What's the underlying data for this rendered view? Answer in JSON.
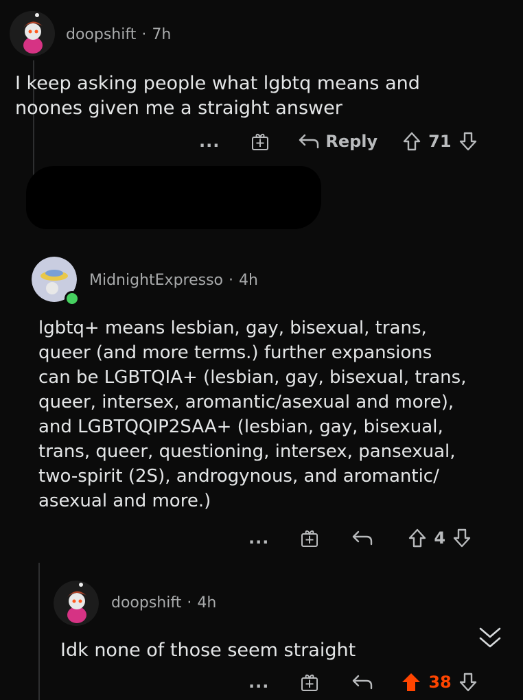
{
  "comments": [
    {
      "username": "doopshift",
      "age": "7h",
      "text_lines": [
        "I keep asking people what lgbtq means and",
        "noones given me a straight answer"
      ],
      "actions": {
        "more": "...",
        "reply_label": "Reply",
        "score": "71"
      }
    },
    {
      "username": "MidnightExpresso",
      "age": "4h",
      "text_lines": [
        "lgbtq+ means lesbian, gay, bisexual, trans,",
        "queer (and more terms.) further expansions",
        "can be LGBTQIA+ (lesbian, gay, bisexual, trans,",
        "queer, intersex, aromantic/asexual and more),",
        "and LGBTQQIP2SAA+ (lesbian, gay, bisexual,",
        "trans, queer, questioning, intersex, pansexual,",
        "two-spirit (2S), androgynous, and aromantic/",
        "asexual and more.)"
      ],
      "actions": {
        "more": "...",
        "score": "4"
      }
    },
    {
      "username": "doopshift",
      "age": "4h",
      "text_lines": [
        "Idk none of those seem straight"
      ],
      "actions": {
        "more": "...",
        "score": "38"
      }
    }
  ],
  "separator": "·",
  "colors": {
    "background": "#0b0b0b",
    "upvote_active": "#ff4500",
    "online_dot": "#46d160",
    "text": "#e4e6e7",
    "meta": "#a8aaab"
  },
  "icons": [
    "award-icon",
    "reply-arrow-icon",
    "upvote-icon",
    "downvote-icon",
    "collapse-chevron-icon"
  ]
}
